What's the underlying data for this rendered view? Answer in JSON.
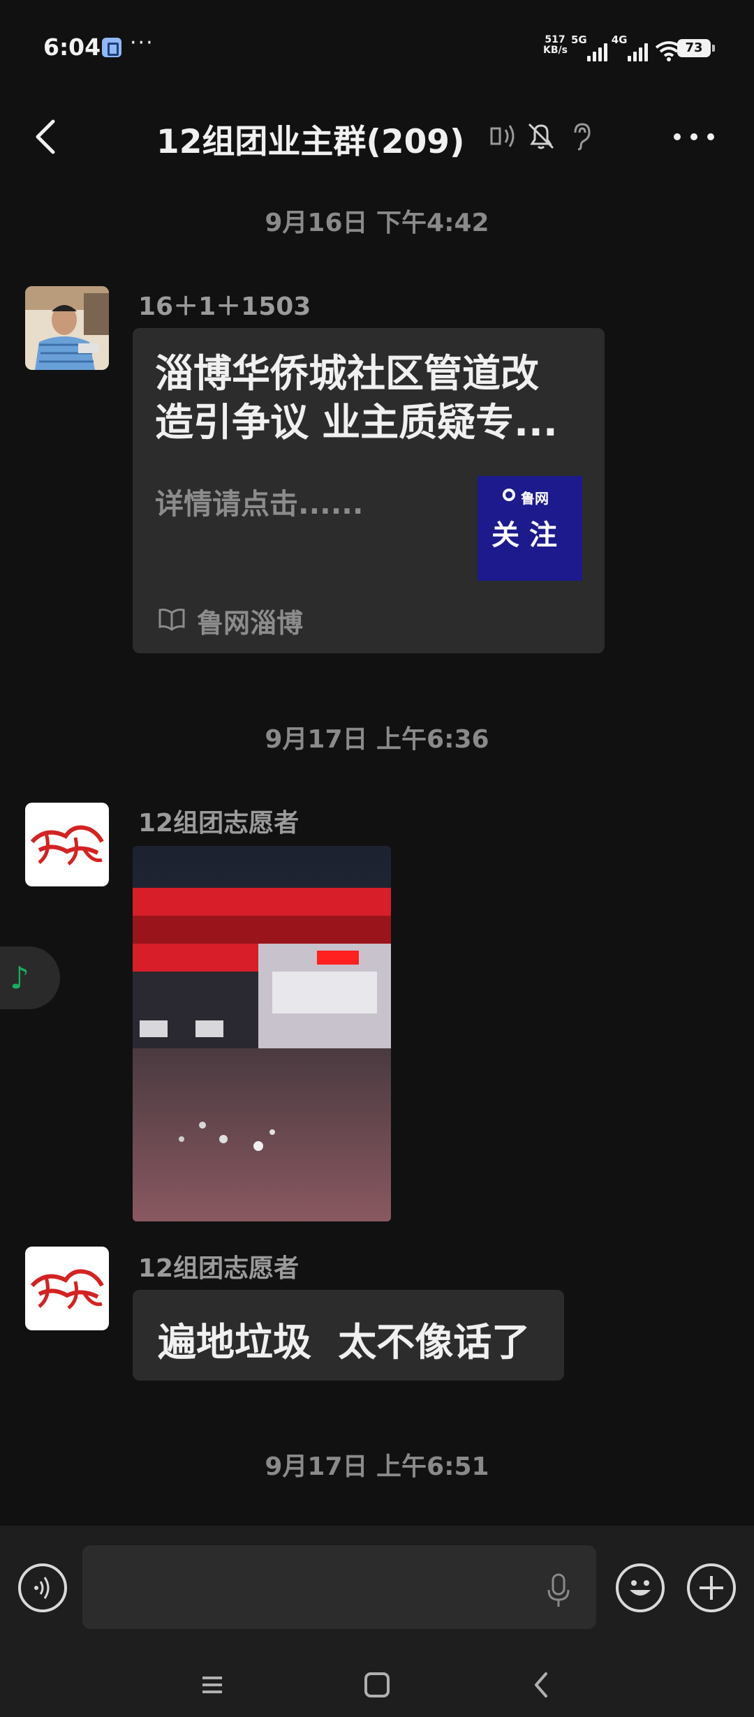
{
  "status_bar": {
    "time": "6:04",
    "speed_value": "517",
    "speed_unit": "KB/s",
    "net1": "5G",
    "net2": "4G",
    "battery": "73"
  },
  "header": {
    "title": "12组团业主群(209)"
  },
  "messages": [
    {
      "time": "9月16日 下午4:42",
      "sender": "16＋1＋1503",
      "type": "article",
      "title": "淄博华侨城社区管道改造引争议 业主质疑专...",
      "desc": "详情请点击......",
      "thumb_brand": "鲁网",
      "thumb_text": "关注",
      "source": "鲁网淄博"
    },
    {
      "time": "9月17日 上午6:36",
      "sender": "12组团志愿者",
      "type": "image"
    },
    {
      "sender": "12组团志愿者",
      "type": "text",
      "text": "遍地垃圾  太不像话了"
    },
    {
      "time": "9月17日 上午6:51"
    }
  ],
  "input": {
    "placeholder": ""
  },
  "colors": {
    "background": "#111111",
    "bubble": "#2c2c2c",
    "card_thumb": "#1c1a8c",
    "music_note": "#1aad5f"
  }
}
